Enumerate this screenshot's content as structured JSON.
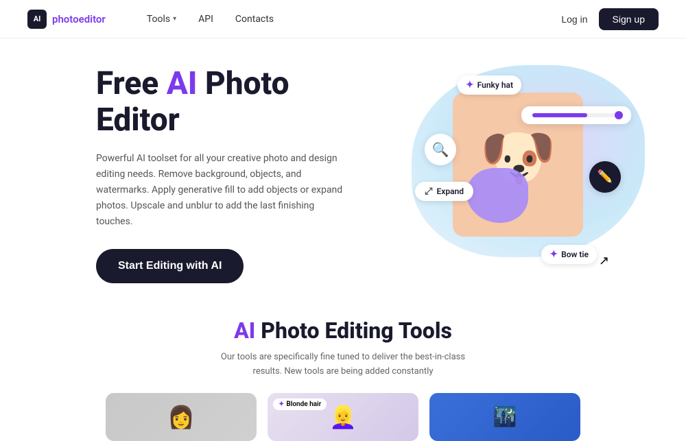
{
  "nav": {
    "logo_icon": "AI",
    "logo_text_plain": "photo",
    "logo_text_accent": "editor",
    "links": [
      {
        "label": "Tools",
        "has_dropdown": true
      },
      {
        "label": "API",
        "has_dropdown": false
      },
      {
        "label": "Contacts",
        "has_dropdown": false
      }
    ],
    "login_label": "Log in",
    "signup_label": "Sign up"
  },
  "hero": {
    "title_plain": "Free ",
    "title_accent": "AI",
    "title_rest": " Photo Editor",
    "description": "Powerful AI toolset for all your creative photo and design editing needs. Remove background, objects, and watermarks. Apply generative fill to add objects or expand photos. Upscale and unblur to add the last finishing touches.",
    "cta_label": "Start Editing with AI"
  },
  "illustration": {
    "tags": {
      "funky_hat": "Funky hat",
      "expand": "Expand",
      "bow_tie": "Bow tie"
    }
  },
  "tools_section": {
    "title_accent": "AI",
    "title_rest": " Photo Editing Tools",
    "description": "Our tools are specifically fine tuned to deliver the best-in-class results. New tools are being added constantly",
    "card2_tag": "Blonde hair"
  }
}
